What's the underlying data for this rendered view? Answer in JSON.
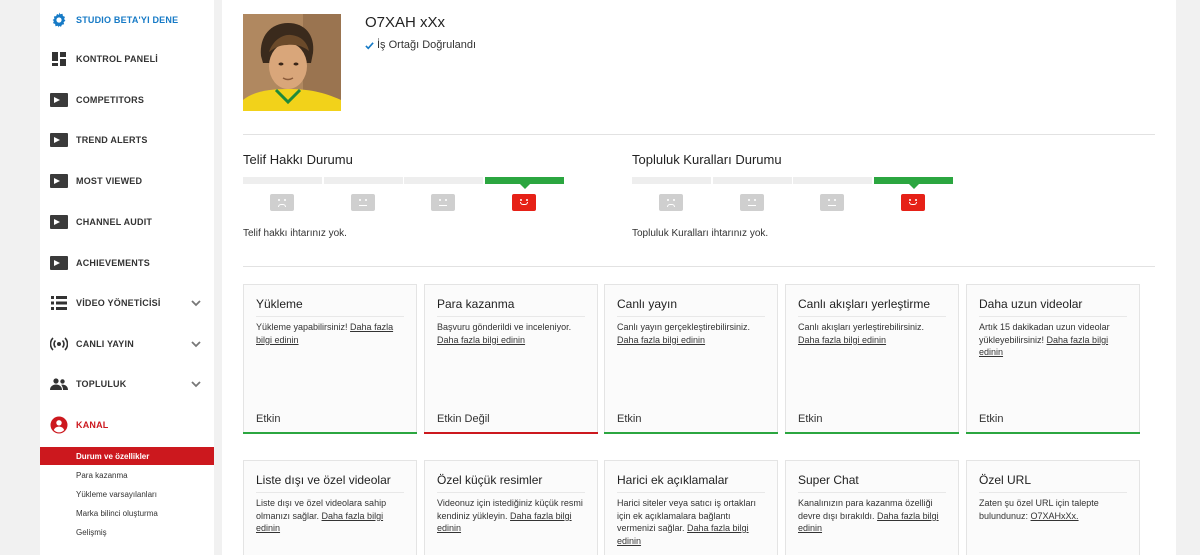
{
  "sidebar": {
    "items": [
      {
        "label": "STUDIO BETA'YI DENE",
        "icon": "gear-icon",
        "color": "#167ac6"
      },
      {
        "label": "KONTROL PANELİ",
        "icon": "dashboard-icon"
      },
      {
        "label": "COMPETITORS",
        "icon": "extension-icon"
      },
      {
        "label": "TREND ALERTS",
        "icon": "extension-icon"
      },
      {
        "label": "MOST VIEWED",
        "icon": "extension-icon"
      },
      {
        "label": "CHANNEL AUDIT",
        "icon": "extension-icon"
      },
      {
        "label": "ACHIEVEMENTS",
        "icon": "extension-icon"
      },
      {
        "label": "VİDEO YÖNETİCİSİ",
        "icon": "video-manager-icon"
      },
      {
        "label": "CANLI YAYIN",
        "icon": "live-broadcast-icon"
      },
      {
        "label": "TOPLULUK",
        "icon": "community-icon"
      },
      {
        "label": "KANAL",
        "icon": "channel-icon",
        "color": "#cc181e"
      }
    ],
    "sub_items": [
      {
        "label": "Durum ve özellikler"
      },
      {
        "label": "Para kazanma"
      },
      {
        "label": "Yükleme varsayılanları"
      },
      {
        "label": "Marka bilinci oluşturma"
      },
      {
        "label": "Gelişmiş"
      }
    ]
  },
  "channel": {
    "name": "O7XAH xXx",
    "verified_label": "İş Ortağı Doğrulandı"
  },
  "copyright": {
    "title": "Telif Hakkı Durumu",
    "note": "Telif hakkı ihtarınız yok.",
    "level": 4,
    "levels_total": 4
  },
  "community": {
    "title": "Topluluk Kuralları Durumu",
    "note": "Topluluk Kuralları ihtarınız yok.",
    "level": 4,
    "levels_total": 4
  },
  "colors": {
    "enabled": "#2ba640",
    "disabled": "#cc181e",
    "accent": "#167ac6"
  },
  "features": [
    {
      "title": "Yükleme",
      "desc": "Yükleme yapabilirsiniz!",
      "link": "Daha fazla bilgi edinin",
      "status": "Etkin",
      "enabled": true
    },
    {
      "title": "Para kazanma",
      "desc": "Başvuru gönderildi ve inceleniyor.",
      "link": "Daha fazla bilgi edinin",
      "status": "Etkin Değil",
      "enabled": false
    },
    {
      "title": "Canlı yayın",
      "desc": "Canlı yayın gerçekleştirebilirsiniz.",
      "link": "Daha fazla bilgi edinin",
      "status": "Etkin",
      "enabled": true
    },
    {
      "title": "Canlı akışları yerleştirme",
      "desc": "Canlı akışları yerleştirebilirsiniz.",
      "link": "Daha fazla bilgi edinin",
      "status": "Etkin",
      "enabled": true
    },
    {
      "title": "Daha uzun videolar",
      "desc": "Artık 15 dakikadan uzun videolar yükleyebilirsiniz!",
      "link": "Daha fazla bilgi edinin",
      "status": "Etkin",
      "enabled": true
    },
    {
      "title": "Liste dışı ve özel videolar",
      "desc": "Liste dışı ve özel videolara sahip olmanızı sağlar.",
      "link": "Daha fazla bilgi edinin"
    },
    {
      "title": "Özel küçük resimler",
      "desc": "Videonuz için istediğiniz küçük resmi kendiniz yükleyin.",
      "link": "Daha fazla bilgi edinin"
    },
    {
      "title": "Harici ek açıklamalar",
      "desc": "Harici siteler veya satıcı iş ortakları için ek açıklamalara bağlantı vermenizi sağlar.",
      "link": "Daha fazla bilgi edinin"
    },
    {
      "title": "Super Chat",
      "desc": "Kanalınızın para kazanma özelliği devre dışı bırakıldı.",
      "link": "Daha fazla bilgi edinin"
    },
    {
      "title": "Özel URL",
      "desc": "Zaten şu özel URL için talepte bulundunuz:",
      "link": "O7XAHxXx."
    }
  ]
}
